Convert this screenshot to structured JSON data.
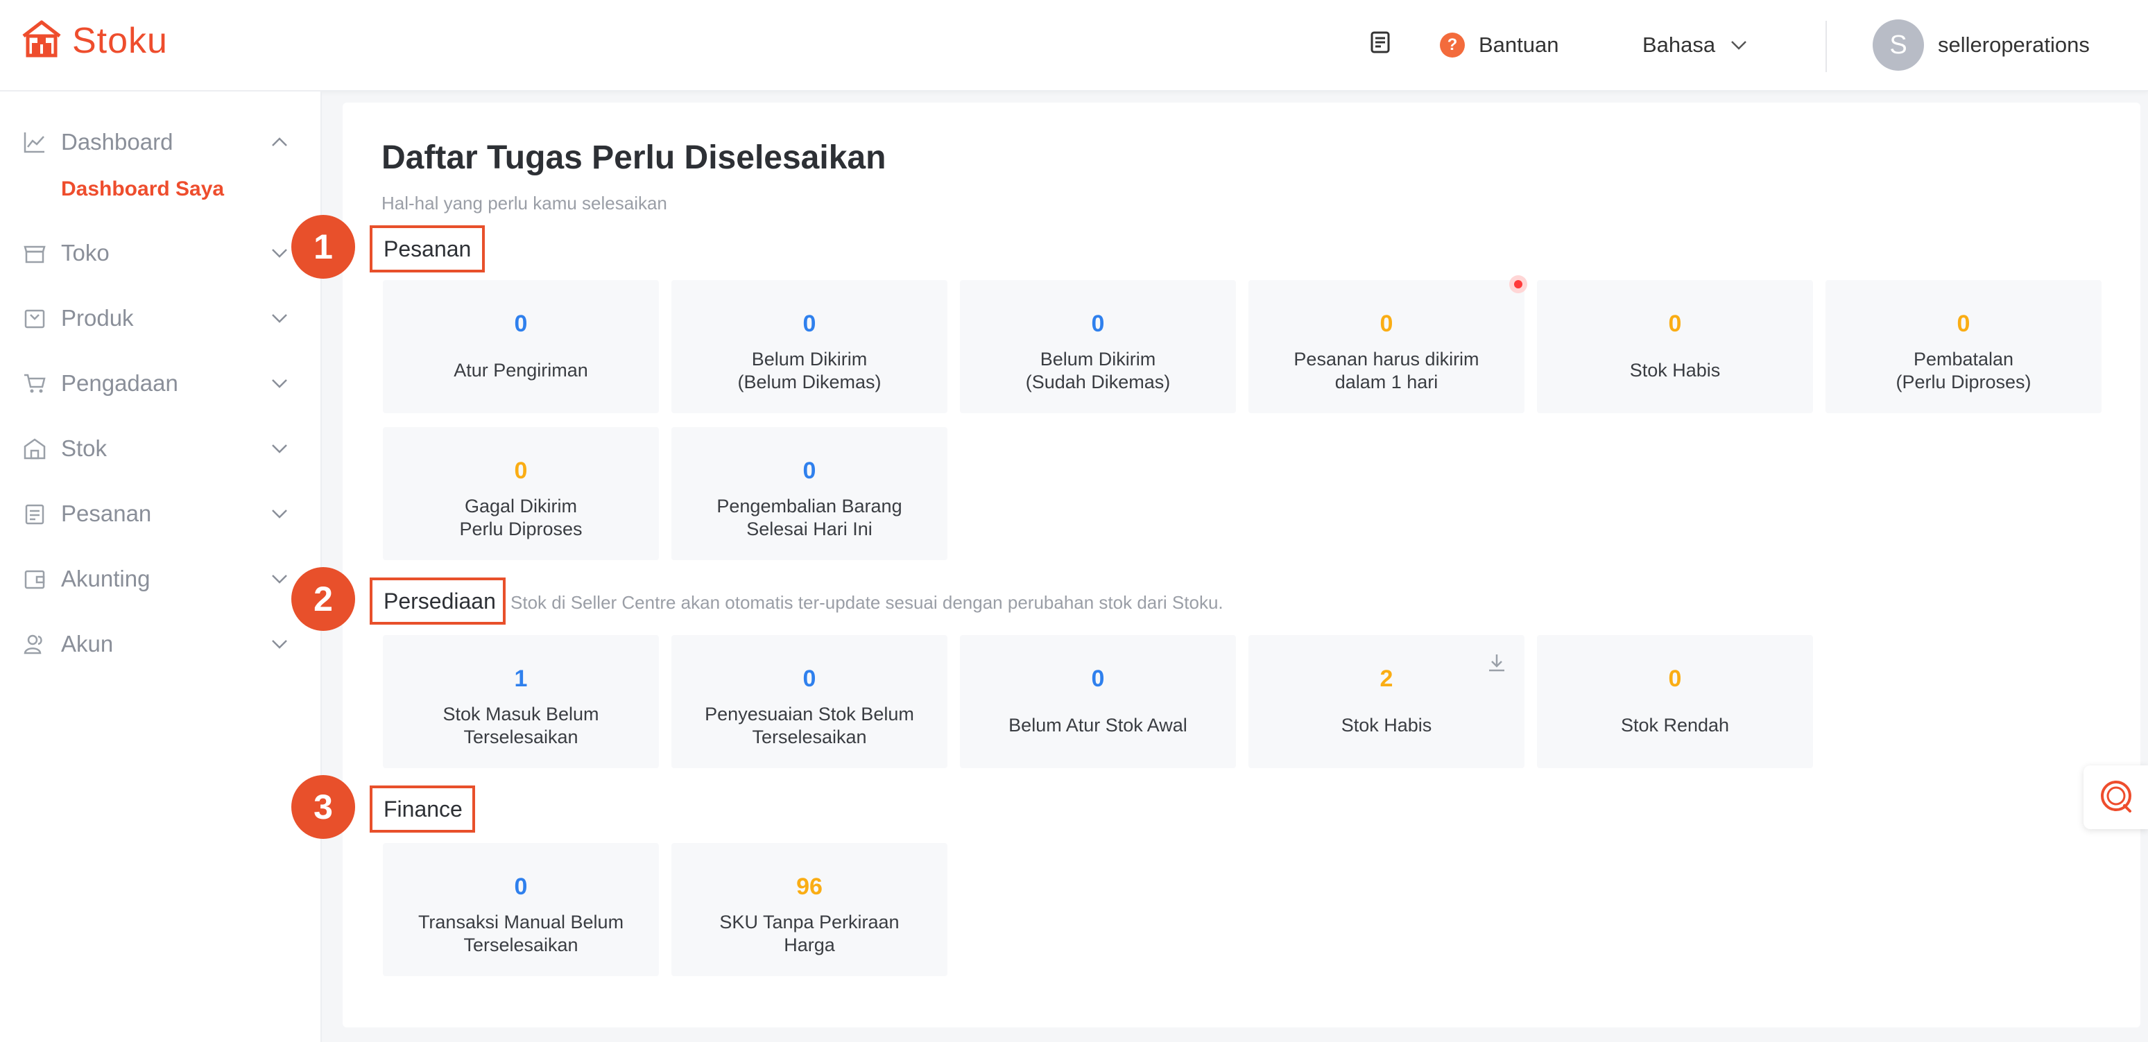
{
  "header": {
    "brand": "Stoku",
    "help_label": "Bantuan",
    "help_icon_glyph": "?",
    "language_label": "Bahasa",
    "avatar_initial": "S",
    "username": "selleroperations"
  },
  "sidebar": {
    "items": [
      {
        "label": "Dashboard",
        "icon": "chart-line-icon",
        "expanded": true
      },
      {
        "label": "Toko",
        "icon": "store-icon"
      },
      {
        "label": "Produk",
        "icon": "product-icon"
      },
      {
        "label": "Pengadaan",
        "icon": "cart-icon"
      },
      {
        "label": "Stok",
        "icon": "warehouse-icon"
      },
      {
        "label": "Pesanan",
        "icon": "clipboard-icon"
      },
      {
        "label": "Akunting",
        "icon": "wallet-icon"
      },
      {
        "label": "Akun",
        "icon": "users-icon"
      }
    ],
    "active_sub": "Dashboard Saya"
  },
  "main": {
    "title": "Daftar Tugas Perlu Diselesaikan",
    "subtitle": "Hal-hal yang perlu kamu selesaikan",
    "sections": [
      {
        "badge": "1",
        "name": "Pesanan",
        "tiles": [
          {
            "value": "0",
            "color": "blue",
            "label": "Atur Pengiriman"
          },
          {
            "value": "0",
            "color": "blue",
            "label": "Belum Dikirim\n(Belum Dikemas)"
          },
          {
            "value": "0",
            "color": "blue",
            "label": "Belum Dikirim\n(Sudah Dikemas)"
          },
          {
            "value": "0",
            "color": "orange",
            "label": "Pesanan harus dikirim\ndalam 1 hari"
          },
          {
            "value": "0",
            "color": "orange",
            "label": "Stok Habis"
          },
          {
            "value": "0",
            "color": "orange",
            "label": "Pembatalan\n(Perlu Diproses)"
          },
          {
            "value": "0",
            "color": "orange",
            "label": "Gagal Dikirim\nPerlu Diproses"
          },
          {
            "value": "0",
            "color": "blue",
            "label": "Pengembalian Barang\nSelesai Hari Ini"
          }
        ]
      },
      {
        "badge": "2",
        "name": "Persediaan",
        "note": "Stok di Seller Centre akan otomatis ter-update sesuai dengan perubahan stok dari Stoku.",
        "tiles": [
          {
            "value": "1",
            "color": "blue",
            "label": "Stok Masuk Belum\nTerselesaikan"
          },
          {
            "value": "0",
            "color": "blue",
            "label": "Penyesuaian Stok Belum\nTerselesaikan"
          },
          {
            "value": "0",
            "color": "blue",
            "label": "Belum Atur Stok Awal"
          },
          {
            "value": "2",
            "color": "orange",
            "label": "Stok Habis"
          },
          {
            "value": "0",
            "color": "orange",
            "label": "Stok Rendah"
          }
        ]
      },
      {
        "badge": "3",
        "name": "Finance",
        "tiles": [
          {
            "value": "0",
            "color": "blue",
            "label": "Transaksi Manual Belum\nTerselesaikan"
          },
          {
            "value": "96",
            "color": "orange",
            "label": "SKU Tanpa Perkiraan\nHarga"
          }
        ]
      }
    ]
  },
  "colors": {
    "accent": "#ee4d2d",
    "annotation": "#e8502b",
    "blue_value": "#2f80ed",
    "orange_value": "#faad14"
  }
}
